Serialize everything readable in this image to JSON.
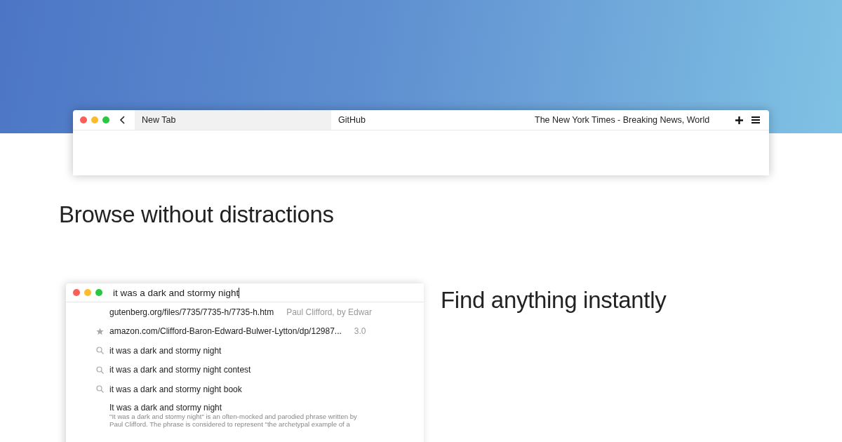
{
  "browser_window": {
    "tabs": [
      {
        "label": "New Tab",
        "selected": true
      },
      {
        "label": "GitHub",
        "selected": false
      },
      {
        "label": "The New York Times - Breaking News, World",
        "selected": false
      }
    ]
  },
  "headline_1": "Browse without distractions",
  "search_window": {
    "query": "it was a dark and stormy night",
    "suggestions": [
      {
        "kind": "url",
        "text": "gutenberg.org/files/7735/7735-h/7735-h.htm",
        "detail": "Paul Clifford, by Edwar"
      },
      {
        "kind": "bookmark",
        "text": "amazon.com/Clifford-Baron-Edward-Bulwer-Lytton/dp/12987...",
        "detail": "3.0"
      },
      {
        "kind": "search",
        "text": "it was a dark and stormy night"
      },
      {
        "kind": "search",
        "text": "it was a dark and stormy night contest"
      },
      {
        "kind": "search",
        "text": "it was a dark and stormy night book"
      },
      {
        "kind": "answer",
        "text": "It was a dark and stormy night",
        "lines": [
          "\"It was a dark and stormy night\" is an often-mocked and parodied phrase written by",
          "Paul Clifford. The phrase is considered to represent \"the archetypal example of a"
        ]
      }
    ]
  },
  "headline_2": "Find anything instantly"
}
